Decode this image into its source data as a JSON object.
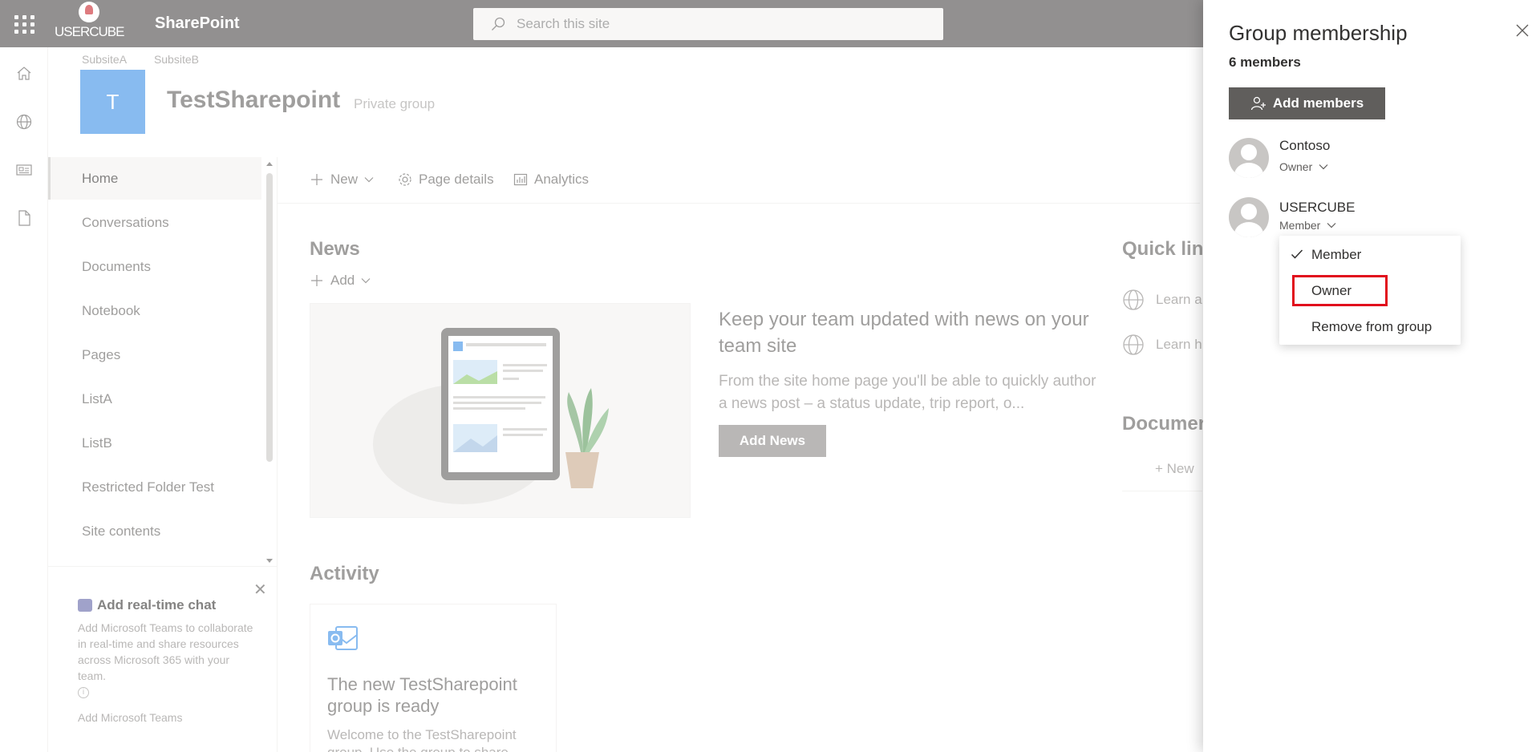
{
  "suite": {
    "app_name": "SharePoint",
    "logo_text": "USERCUBE",
    "search_placeholder": "Search this site"
  },
  "site": {
    "hub_links": [
      "SubsiteA",
      "SubsiteB"
    ],
    "logo_letter": "T",
    "title": "TestSharepoint",
    "privacy": "Private group"
  },
  "nav": {
    "items": [
      "Home",
      "Conversations",
      "Documents",
      "Notebook",
      "Pages",
      "ListA",
      "ListB",
      "Restricted Folder Test",
      "Site contents"
    ],
    "active": "Home"
  },
  "teams_promo": {
    "title": "Add real-time chat",
    "description": "Add Microsoft Teams to collaborate in real-time and share resources across Microsoft 365 with your team.",
    "link": "Add Microsoft Teams"
  },
  "command_bar": {
    "new_label": "New",
    "page_details_label": "Page details",
    "analytics_label": "Analytics"
  },
  "news": {
    "title": "News",
    "add_label": "Add",
    "headline": "Keep your team updated with news on your team site",
    "body": "From the site home page you'll be able to quickly author a news post – a status update, trip report, o...",
    "button": "Add News"
  },
  "quick_links": {
    "title": "Quick lin",
    "items": [
      "Learn a",
      "Learn h"
    ]
  },
  "documents": {
    "title": "Documer",
    "new_label": "New"
  },
  "activity": {
    "title": "Activity",
    "card_title": "The new TestSharepoint group is ready",
    "card_body": "Welcome to the TestSharepoint group. Use the group to share"
  },
  "panel": {
    "title": "Group membership",
    "count": "6 members",
    "add_button": "Add members",
    "members": [
      {
        "name": "Contoso",
        "role": "Owner"
      },
      {
        "name": "USERCUBE",
        "role": "Member"
      }
    ]
  },
  "role_menu": {
    "options": [
      "Member",
      "Owner",
      "Remove from group"
    ],
    "selected": "Member",
    "highlighted": "Owner"
  },
  "colors": {
    "suite_bar": "#4a4747",
    "site_logo": "#3a8ee6",
    "highlight": "#e10d1c",
    "add_members_button": "#605e5c"
  }
}
